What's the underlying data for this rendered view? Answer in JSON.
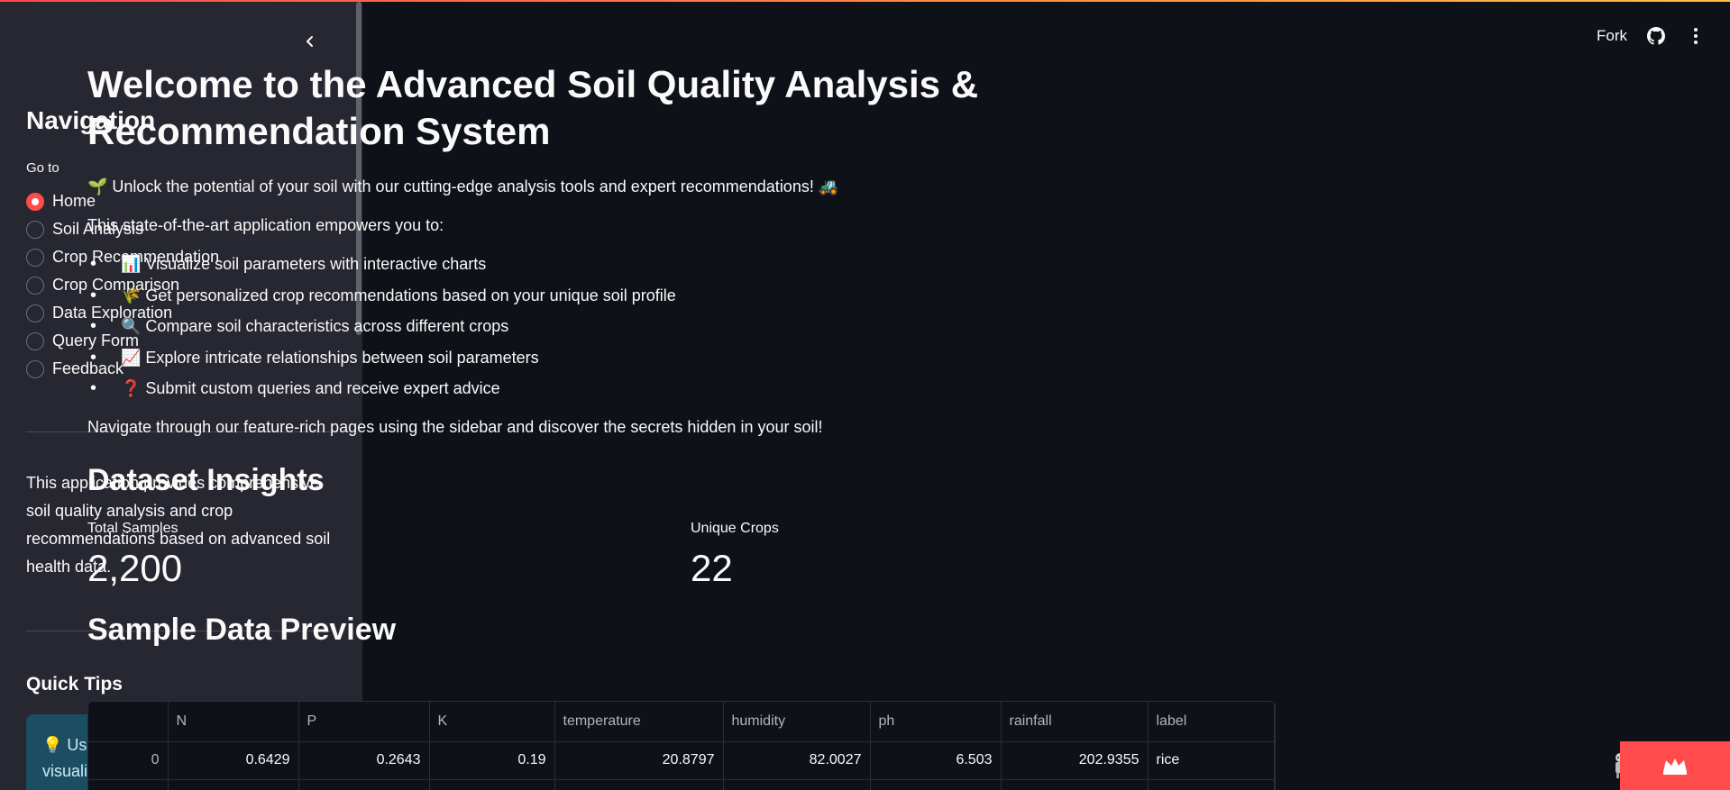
{
  "header": {
    "fork_label": "Fork",
    "github_icon": "github-icon",
    "menu_icon": "kebab-menu-icon"
  },
  "sidebar": {
    "collapse_icon": "chevron-left-icon",
    "nav_title": "Navigation",
    "radio_label": "Go to",
    "items": [
      {
        "label": "Home",
        "selected": true
      },
      {
        "label": "Soil Analysis",
        "selected": false
      },
      {
        "label": "Crop Recommendation",
        "selected": false
      },
      {
        "label": "Crop Comparison",
        "selected": false
      },
      {
        "label": "Data Exploration",
        "selected": false
      },
      {
        "label": "Query Form",
        "selected": false
      },
      {
        "label": "Feedback",
        "selected": false
      }
    ],
    "description": "This application provides comprehensive soil quality analysis and crop recommendations based on advanced soil health data.",
    "tips_title": "Quick Tips",
    "tip_text": "💡 Use the Soil Analysis page to visualize soil parameters for different"
  },
  "main": {
    "title": "Welcome to the Advanced Soil Quality Analysis & Recommendation System",
    "intro": "🌱 Unlock the potential of your soil with our cutting-edge analysis tools and expert recommendations! 🚜",
    "intro2": "This state-of-the-art application empowers you to:",
    "features": [
      "📊 Visualize soil parameters with interactive charts",
      "🌾 Get personalized crop recommendations based on your unique soil profile",
      "🔍 Compare soil characteristics across different crops",
      "📈 Explore intricate relationships between soil parameters",
      "❓ Submit custom queries and receive expert advice"
    ],
    "outro": "Navigate through our feature-rich pages using the sidebar and discover the secrets hidden in your soil!",
    "insights_title": "Dataset Insights",
    "metrics": [
      {
        "label": "Total Samples",
        "value": "2,200"
      },
      {
        "label": "Unique Crops",
        "value": "22"
      }
    ],
    "preview_title": "Sample Data Preview",
    "table": {
      "columns": [
        "",
        "N",
        "P",
        "K",
        "temperature",
        "humidity",
        "ph",
        "rainfall",
        "label"
      ],
      "rows": [
        [
          "0",
          "0.6429",
          "0.2643",
          "0.19",
          "20.8797",
          "82.0027",
          "6.503",
          "202.9355",
          "rice"
        ]
      ]
    }
  },
  "colors": {
    "accent": "#ff4b4b",
    "sidebar_bg": "#262730",
    "main_bg": "#0e1117",
    "tip_bg": "#1c4e63"
  }
}
